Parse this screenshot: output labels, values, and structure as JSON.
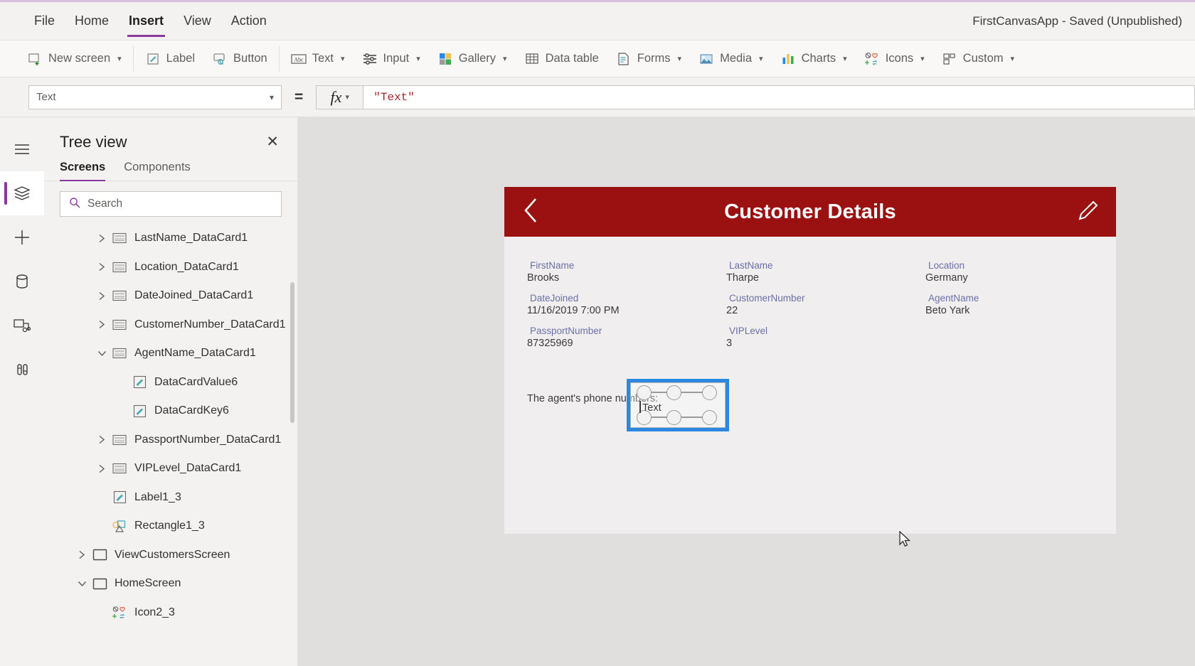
{
  "menu": {
    "items": [
      {
        "label": "File",
        "active": false
      },
      {
        "label": "Home",
        "active": false
      },
      {
        "label": "Insert",
        "active": true
      },
      {
        "label": "View",
        "active": false
      },
      {
        "label": "Action",
        "active": false
      }
    ],
    "app_status": "FirstCanvasApp - Saved (Unpublished)"
  },
  "ribbon": {
    "groups": [
      {
        "items": [
          {
            "label": "New screen",
            "icon": "new-screen-icon",
            "chevron": true
          }
        ]
      },
      {
        "items": [
          {
            "label": "Label",
            "icon": "label-icon",
            "chevron": false
          },
          {
            "label": "Button",
            "icon": "button-icon",
            "chevron": false
          }
        ]
      },
      {
        "items": [
          {
            "label": "Text",
            "icon": "text-icon",
            "chevron": true
          },
          {
            "label": "Input",
            "icon": "input-icon",
            "chevron": true
          },
          {
            "label": "Gallery",
            "icon": "gallery-icon",
            "chevron": true
          },
          {
            "label": "Data table",
            "icon": "data-table-icon",
            "chevron": false
          },
          {
            "label": "Forms",
            "icon": "forms-icon",
            "chevron": true
          },
          {
            "label": "Media",
            "icon": "media-icon",
            "chevron": true
          },
          {
            "label": "Charts",
            "icon": "charts-icon",
            "chevron": true
          },
          {
            "label": "Icons",
            "icon": "icons-icon",
            "chevron": true
          },
          {
            "label": "Custom",
            "icon": "custom-icon",
            "chevron": true
          }
        ]
      }
    ]
  },
  "formula_bar": {
    "property": "Text",
    "equals": "=",
    "fx_label": "fx",
    "formula": "\"Text\""
  },
  "rail": {
    "items": [
      {
        "name": "hamburger-menu-icon",
        "selected": false
      },
      {
        "name": "tree-view-icon",
        "selected": true
      },
      {
        "name": "insert-plus-icon",
        "selected": false
      },
      {
        "name": "data-sources-icon",
        "selected": false
      },
      {
        "name": "media-library-icon",
        "selected": false
      },
      {
        "name": "advanced-tools-icon",
        "selected": false
      }
    ]
  },
  "tree_view": {
    "title": "Tree view",
    "close_label": "✕",
    "tabs": [
      {
        "label": "Screens",
        "active": true
      },
      {
        "label": "Components",
        "active": false
      }
    ],
    "search_placeholder": "Search",
    "nodes": [
      {
        "label": "LastName_DataCard1",
        "indent": 2,
        "twisty": "collapsed",
        "icon": "datacard-icon"
      },
      {
        "label": "Location_DataCard1",
        "indent": 2,
        "twisty": "collapsed",
        "icon": "datacard-icon"
      },
      {
        "label": "DateJoined_DataCard1",
        "indent": 2,
        "twisty": "collapsed",
        "icon": "datacard-icon"
      },
      {
        "label": "CustomerNumber_DataCard1",
        "indent": 2,
        "twisty": "collapsed",
        "icon": "datacard-icon"
      },
      {
        "label": "AgentName_DataCard1",
        "indent": 2,
        "twisty": "expanded",
        "icon": "datacard-icon"
      },
      {
        "label": "DataCardValue6",
        "indent": 3,
        "twisty": "none",
        "icon": "label-control-icon"
      },
      {
        "label": "DataCardKey6",
        "indent": 3,
        "twisty": "none",
        "icon": "label-control-icon"
      },
      {
        "label": "PassportNumber_DataCard1",
        "indent": 2,
        "twisty": "collapsed",
        "icon": "datacard-icon"
      },
      {
        "label": "VIPLevel_DataCard1",
        "indent": 2,
        "twisty": "collapsed",
        "icon": "datacard-icon"
      },
      {
        "label": "Label1_3",
        "indent": 2,
        "twisty": "none",
        "icon": "label-control-icon"
      },
      {
        "label": "Rectangle1_3",
        "indent": 2,
        "twisty": "none",
        "icon": "rectangle-icon"
      },
      {
        "label": "ViewCustomersScreen",
        "indent": 1,
        "twisty": "collapsed",
        "icon": "screen-icon"
      },
      {
        "label": "HomeScreen",
        "indent": 1,
        "twisty": "expanded",
        "icon": "screen-icon"
      },
      {
        "label": "Icon2_3",
        "indent": 2,
        "twisty": "none",
        "icon": "icons-icon"
      }
    ]
  },
  "canvas": {
    "screen": {
      "header": {
        "title": "Customer Details",
        "back_icon": "chevron-left-icon",
        "edit_icon": "pencil-icon",
        "bg_color": "#9b1010"
      },
      "fields": [
        [
          {
            "key": "FirstName",
            "value": "Brooks"
          },
          {
            "key": "LastName",
            "value": "Tharpe"
          },
          {
            "key": "Location",
            "value": "Germany"
          }
        ],
        [
          {
            "key": "DateJoined",
            "value": "11/16/2019 7:00 PM"
          },
          {
            "key": "CustomerNumber",
            "value": "22"
          },
          {
            "key": "AgentName",
            "value": "Beto Yark"
          }
        ],
        [
          {
            "key": "PassportNumber",
            "value": "87325969"
          },
          {
            "key": "VIPLevel",
            "value": "3"
          },
          {
            "key": "",
            "value": ""
          }
        ]
      ],
      "static_label": "The agent's phone numbers:",
      "selected_control": {
        "text": "Text",
        "border_color": "#2b88e0"
      }
    }
  }
}
